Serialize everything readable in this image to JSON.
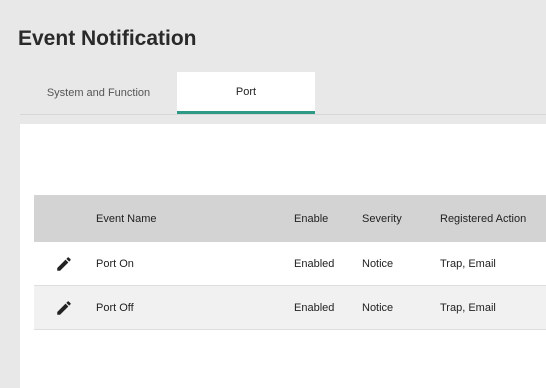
{
  "page": {
    "title": "Event Notification"
  },
  "tabs": [
    {
      "label": "System and Function",
      "active": false
    },
    {
      "label": "Port",
      "active": true
    }
  ],
  "table": {
    "headers": {
      "event_name": "Event Name",
      "enable": "Enable",
      "severity": "Severity",
      "registered_action": "Registered Action"
    },
    "rows": [
      {
        "event_name": "Port On",
        "enable": "Enabled",
        "severity": "Notice",
        "registered_action": "Trap, Email",
        "edit_icon": "pencil-icon"
      },
      {
        "event_name": "Port Off",
        "enable": "Enabled",
        "severity": "Notice",
        "registered_action": "Trap, Email",
        "edit_icon": "pencil-icon"
      }
    ]
  },
  "colors": {
    "accent": "#2e9a86",
    "header_bg": "#d3d3d3",
    "page_bg": "#e8e8e8"
  }
}
